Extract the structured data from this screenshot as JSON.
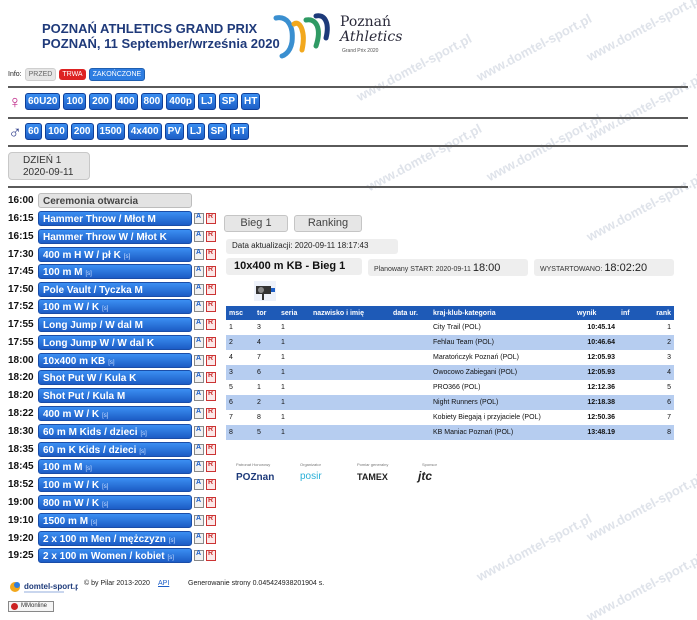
{
  "header": {
    "title_line1": "POZNAŃ ATHLETICS GRAND PRIX",
    "title_line2": "POZNAŃ, 11 September/września 2020",
    "logo_line1": "Poznań",
    "logo_line2": "Athletics",
    "logo_line3": "Grand Prix 2020"
  },
  "info": {
    "label": "Info:",
    "statuses": [
      "PRZED",
      "TRWA",
      "ZAKOŃCZONE"
    ]
  },
  "women": {
    "symbol": "♀",
    "events": [
      "60U20",
      "100",
      "200",
      "400",
      "800",
      "400p",
      "LJ",
      "SP",
      "HT"
    ]
  },
  "men": {
    "symbol": "♂",
    "events": [
      "60",
      "100",
      "200",
      "1500",
      "4x400",
      "PV",
      "LJ",
      "SP",
      "HT"
    ]
  },
  "day": {
    "label": "DZIEŃ 1",
    "date": "2020-09-11"
  },
  "schedule": [
    {
      "time": "16:00",
      "name": "Ceremonia otwarcia",
      "grey": true,
      "s": "",
      "icons": false
    },
    {
      "time": "16:15",
      "name": "Hammer Throw / Młot M",
      "s": "",
      "icons": true
    },
    {
      "time": "16:15",
      "name": "Hammer Throw W / Młot K",
      "s": "",
      "icons": true
    },
    {
      "time": "17:30",
      "name": "400 m H W / pł K",
      "s": "[s]",
      "icons": true
    },
    {
      "time": "17:45",
      "name": "100 m M",
      "s": "[s]",
      "icons": true
    },
    {
      "time": "17:50",
      "name": "Pole Vault / Tyczka M",
      "s": "",
      "icons": true
    },
    {
      "time": "17:52",
      "name": "100 m W / K",
      "s": "[s]",
      "icons": true
    },
    {
      "time": "17:55",
      "name": "Long Jump / W dal M",
      "s": "",
      "icons": true
    },
    {
      "time": "17:55",
      "name": "Long Jump W / W dal K",
      "s": "",
      "icons": true
    },
    {
      "time": "18:00",
      "name": "10x400 m KB",
      "s": "[s]",
      "icons": true
    },
    {
      "time": "18:20",
      "name": "Shot Put W / Kula K",
      "s": "",
      "icons": true
    },
    {
      "time": "18:20",
      "name": "Shot Put / Kula M",
      "s": "",
      "icons": true
    },
    {
      "time": "18:22",
      "name": "400 m W / K",
      "s": "[s]",
      "icons": true
    },
    {
      "time": "18:30",
      "name": "60 m M Kids / dzieci",
      "s": "[s]",
      "icons": true
    },
    {
      "time": "18:35",
      "name": "60 m K Kids / dzieci",
      "s": "[s]",
      "icons": true
    },
    {
      "time": "18:45",
      "name": "100 m M",
      "s": "[s]",
      "icons": true
    },
    {
      "time": "18:52",
      "name": "100 m W / K",
      "s": "[s]",
      "icons": true
    },
    {
      "time": "19:00",
      "name": "800 m W / K",
      "s": "[s]",
      "icons": true
    },
    {
      "time": "19:10",
      "name": "1500 m M",
      "s": "[s]",
      "icons": true
    },
    {
      "time": "19:20",
      "name": "2 x 100 m Men / mężczyzn",
      "s": "[s]",
      "icons": true
    },
    {
      "time": "19:25",
      "name": "2 x 100 m Women / kobiet",
      "s": "[s]",
      "icons": true
    }
  ],
  "panel": {
    "tab1": "Bieg 1",
    "tab2": "Ranking",
    "updated": "Data aktualizacji: 2020-09-11 18:17:43",
    "race": "10x400 m KB - Bieg 1",
    "planned_label": "Planowany START: 2020-09-11",
    "planned_time": "18:00",
    "started_label": "WYSTARTOWANO:",
    "started_time": "18:02:20"
  },
  "results": {
    "headers": [
      "msc",
      "tor",
      "seria",
      "nazwisko i imię",
      "data ur.",
      "kraj-klub-kategoria",
      "wynik",
      "inf",
      "rank"
    ],
    "rows": [
      {
        "msc": "1",
        "tor": "3",
        "seria": "1",
        "club": "City Trail (POL)",
        "wynik": "10:45.14",
        "rank": "1"
      },
      {
        "msc": "2",
        "tor": "4",
        "seria": "1",
        "club": "Fehlau Team (POL)",
        "wynik": "10:46.64",
        "rank": "2"
      },
      {
        "msc": "4",
        "tor": "7",
        "seria": "1",
        "club": "Maratończyk Poznań (POL)",
        "wynik": "12:05.93",
        "rank": "3"
      },
      {
        "msc": "3",
        "tor": "6",
        "seria": "1",
        "club": "Owocowo Zabiegani (POL)",
        "wynik": "12:05.93",
        "rank": "4"
      },
      {
        "msc": "5",
        "tor": "1",
        "seria": "1",
        "club": "PRO366 (POL)",
        "wynik": "12:12.36",
        "rank": "5"
      },
      {
        "msc": "6",
        "tor": "2",
        "seria": "1",
        "club": "Night Runners (POL)",
        "wynik": "12:18.38",
        "rank": "6"
      },
      {
        "msc": "7",
        "tor": "8",
        "seria": "1",
        "club": "Kobiety Biegają i przyjaciele (POL)",
        "wynik": "12:50.36",
        "rank": "7"
      },
      {
        "msc": "8",
        "tor": "5",
        "seria": "1",
        "club": "KB Maniac Poznań (POL)",
        "wynik": "13:48.19",
        "rank": "8"
      }
    ]
  },
  "sponsors": {
    "s1_label": "Patronat Honorowy",
    "s1_name": "POZnan",
    "s2_label": "Organizator",
    "s2_name": "posir",
    "s3_label": "Pomiar generalny",
    "s3_name": "TAMEX",
    "s4_label": "Sponsor",
    "s4_name": "jtc"
  },
  "footer": {
    "logo": "domtel-sport.pl",
    "copyright": "© by Pilar 2013-2020",
    "api": "API",
    "generated": "Generowanie strony 0.045424938201904 s.",
    "badge": "MMonline"
  },
  "colors": {
    "button_blue": "#1d5fc7",
    "table_header": "#1e5ab7",
    "row_highlight": "#b6cdf0",
    "live_red": "#dd2222"
  }
}
